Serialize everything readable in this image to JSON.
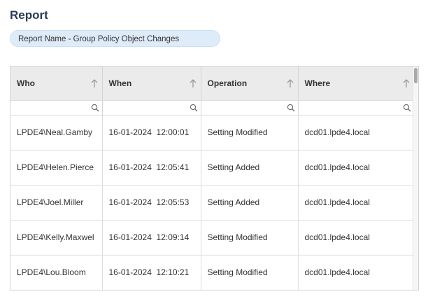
{
  "page": {
    "title": "Report",
    "report_name": "Report Name - Group Policy Object Changes"
  },
  "grid": {
    "columns": [
      {
        "label": "Who",
        "sort_icon": "arrow-up-icon",
        "filter_value": "",
        "filter_icon": "search-icon"
      },
      {
        "label": "When",
        "sort_icon": "arrow-up-icon",
        "filter_value": "",
        "filter_icon": "search-icon"
      },
      {
        "label": "Operation",
        "sort_icon": "arrow-up-icon",
        "filter_value": "",
        "filter_icon": "search-icon"
      },
      {
        "label": "Where",
        "sort_icon": "arrow-up-icon",
        "filter_value": "",
        "filter_icon": "search-icon"
      }
    ],
    "rows": [
      {
        "who": "LPDE4\\Neal.Gamby",
        "when": "16-01-2024  12:00:01",
        "operation": "Setting Modified",
        "where": "dcd01.lpde4.local"
      },
      {
        "who": "LPDE4\\Helen.Pierce",
        "when": "16-01-2024  12:05:41",
        "operation": "Setting Added",
        "where": "dcd01.lpde4.local"
      },
      {
        "who": "LPDE4\\Joel.Miller",
        "when": "16-01-2024  12:05:53",
        "operation": "Setting Added",
        "where": "dcd01.lpde4.local"
      },
      {
        "who": "LPDE4\\Kelly.Maxwel",
        "when": "16-01-2024  12:09:14",
        "operation": "Setting Modified",
        "where": "dcd01.lpde4.local"
      },
      {
        "who": "LPDE4\\Lou.Bloom",
        "when": "16-01-2024  12:10:21",
        "operation": "Setting Modified",
        "where": "dcd01.lpde4.local"
      }
    ]
  },
  "colors": {
    "title": "#2a3c55",
    "pill_background": "#deebf8",
    "header_background": "#ebebeb",
    "border": "#d4d4d4"
  }
}
